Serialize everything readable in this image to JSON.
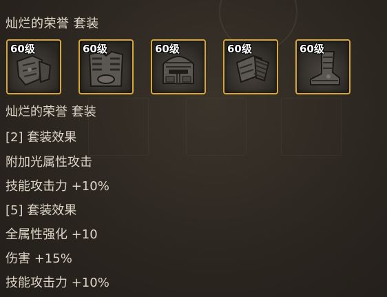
{
  "set": {
    "title": "灿烂的荣誉  套装",
    "items": [
      {
        "level": "60级",
        "icon": "shoulder-armor-icon"
      },
      {
        "level": "60级",
        "icon": "chest-armor-icon"
      },
      {
        "level": "60级",
        "icon": "helmet-icon"
      },
      {
        "level": "60级",
        "icon": "belt-armor-icon"
      },
      {
        "level": "60级",
        "icon": "boots-icon"
      }
    ]
  },
  "info": {
    "set_name": "灿烂的荣誉  套装",
    "bonus2_header": "[2] 套装效果",
    "bonus2_line1": "附加光属性攻击",
    "bonus2_line2": "技能攻击力 +10%",
    "bonus5_header": "[5] 套装效果",
    "bonus5_line1": "全属性强化 +10",
    "bonus5_line2": "伤害 +15%",
    "bonus5_line3": "技能攻击力 +10%"
  },
  "colors": {
    "frame_gold": "#d9a733",
    "text": "#dcd5c8",
    "background": "#2b2620"
  }
}
